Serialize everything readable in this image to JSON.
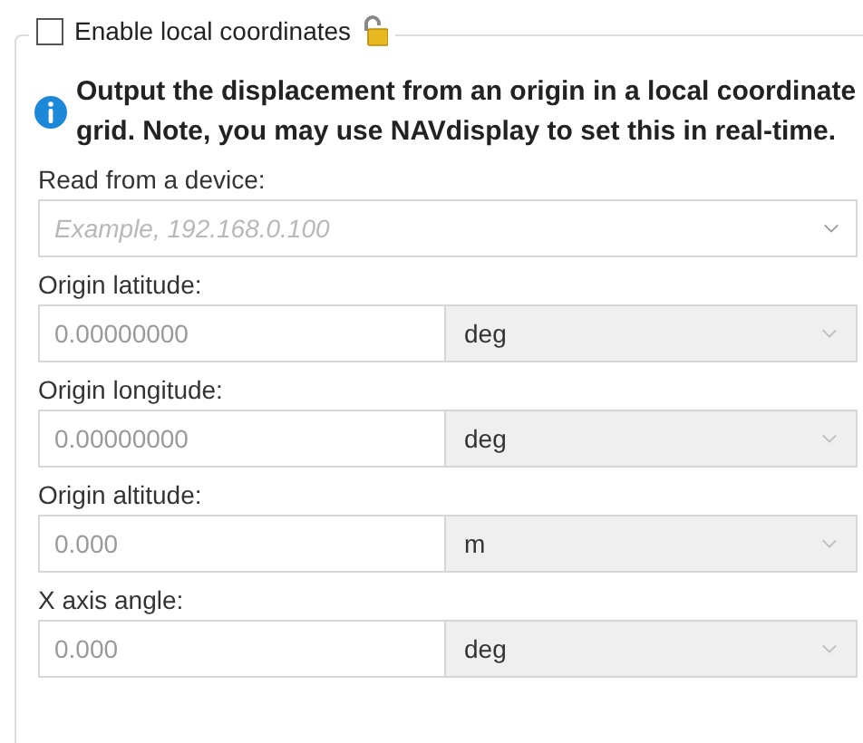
{
  "group": {
    "title": "Enable local coordinates",
    "checked": false
  },
  "info": "Output the displacement from an origin in a local coordinate grid. Note, you may use NAVdisplay to set this in real-time.",
  "device": {
    "label": "Read from a device:",
    "placeholder": "Example, 192.168.0.100"
  },
  "fields": [
    {
      "label": "Origin latitude:",
      "value": "0.00000000",
      "unit": "deg"
    },
    {
      "label": "Origin longitude:",
      "value": "0.00000000",
      "unit": "deg"
    },
    {
      "label": "Origin altitude:",
      "value": "0.000",
      "unit": "m"
    },
    {
      "label": "X axis angle:",
      "value": "0.000",
      "unit": "deg"
    }
  ]
}
